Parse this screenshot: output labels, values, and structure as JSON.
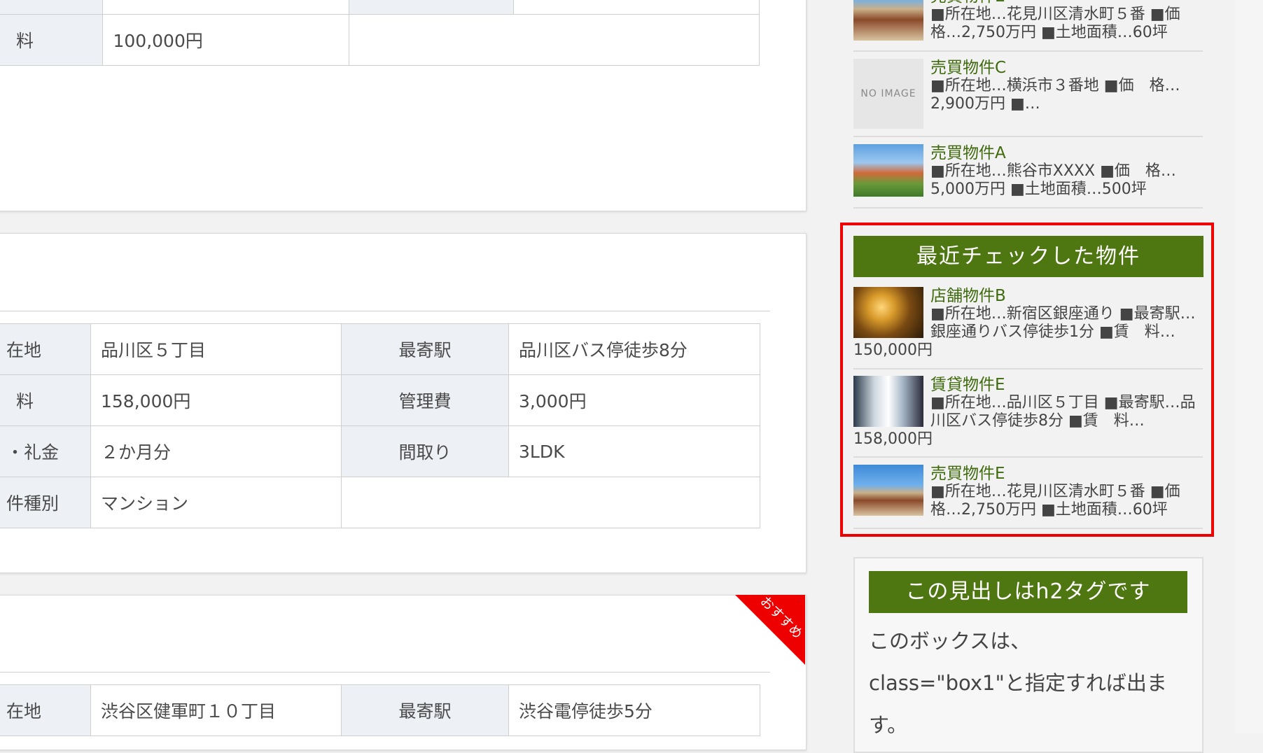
{
  "card_a": {
    "row": {
      "label": "料",
      "value": "100,000円"
    }
  },
  "card_b": {
    "rows": [
      {
        "l1": "在地",
        "v1": "品川区５丁目",
        "l2": "最寄駅",
        "v2": "品川区バス停徒歩8分"
      },
      {
        "l1": "料",
        "v1": "158,000円",
        "l2": "管理費",
        "v2": "3,000円"
      },
      {
        "l1": "・礼金",
        "v1": "２か月分",
        "l2": "間取り",
        "v2": "3LDK"
      },
      {
        "l1": "件種別",
        "v1": "マンション",
        "l2": "",
        "v2": ""
      }
    ]
  },
  "card_c": {
    "ribbon": "おすすめ",
    "row": {
      "l1": "在地",
      "v1": "渋谷区健軍町１０丁目",
      "l2": "最寄駅",
      "v2": "渋谷電停徒歩5分"
    }
  },
  "sidebar": {
    "top_list": [
      {
        "title": "売買物件E",
        "line1": "■所在地…花見川区清水町５番 ■価",
        "line2": "格…2,750万円 ■土地面積…60坪",
        "thumb": "villa"
      },
      {
        "title": "売買物件C",
        "line1": "■所在地…横浜市３番地 ■価　格…",
        "line2": "2,900万円 ■…",
        "thumb": "none",
        "no_image": "NO IMAGE"
      },
      {
        "title": "売買物件A",
        "line1": "■所在地…熊谷市XXXX ■価　格…",
        "line2": "5,000万円 ■土地面積…500坪",
        "thumb": "castle"
      }
    ],
    "recent": {
      "heading": "最近チェックした物件",
      "items": [
        {
          "title": "店舗物件B",
          "line1": "■所在地…新宿区銀座通り ■最寄駅…",
          "line2": "銀座通りバス停徒歩1分 ■賃　料…",
          "line3": "150,000円",
          "thumb": "shop"
        },
        {
          "title": "賃貸物件E",
          "line1": "■所在地…品川区５丁目 ■最寄駅…品",
          "line2": "川区バス停徒歩8分 ■賃　料…",
          "line3": "158,000円",
          "thumb": "street"
        },
        {
          "title": "売買物件E",
          "line1": "■所在地…花見川区清水町５番 ■価",
          "line2": "格…2,750万円 ■土地面積…60坪",
          "thumb": "villa"
        }
      ]
    },
    "box1": {
      "heading": "この見出しはh2タグです",
      "line1": "このボックスは、",
      "line2": "class=\"box1\"と指定すれば出ま",
      "line3": "す。"
    }
  },
  "colors": {
    "accent_green": "#4e7712",
    "link_green": "#3f6a0d",
    "highlight_red": "#ee0000"
  }
}
